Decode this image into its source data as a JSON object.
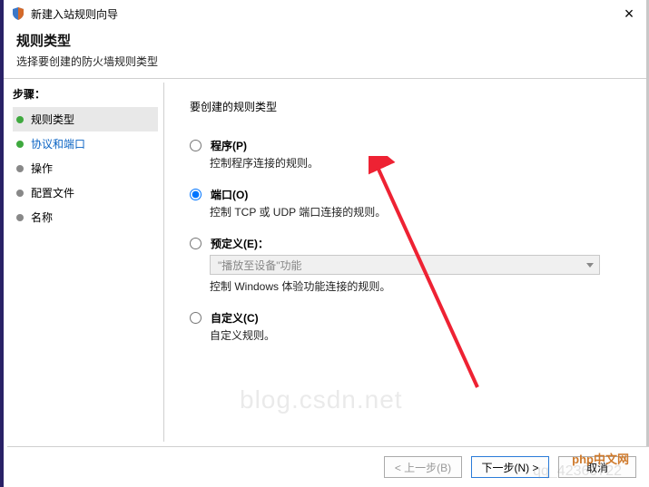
{
  "window": {
    "title": "新建入站规则向导",
    "close_label": "×"
  },
  "header": {
    "title": "规则类型",
    "subtitle": "选择要创建的防火墙规则类型"
  },
  "sidebar": {
    "title": "步骤：",
    "steps": [
      {
        "label": "规则类型",
        "current": true,
        "color": "green",
        "link": false
      },
      {
        "label": "协议和端口",
        "current": false,
        "color": "green",
        "link": true
      },
      {
        "label": "操作",
        "current": false,
        "color": "gray",
        "link": false
      },
      {
        "label": "配置文件",
        "current": false,
        "color": "gray",
        "link": false
      },
      {
        "label": "名称",
        "current": false,
        "color": "gray",
        "link": false
      }
    ]
  },
  "main": {
    "prompt": "要创建的规则类型",
    "options": [
      {
        "id": "program",
        "label": "程序(P)",
        "desc": "控制程序连接的规则。",
        "checked": false
      },
      {
        "id": "port",
        "label": "端口(O)",
        "desc": "控制 TCP 或 UDP 端口连接的规则。",
        "checked": true
      },
      {
        "id": "predefined",
        "label": "预定义(E)：",
        "desc": "控制 Windows 体验功能连接的规则。",
        "checked": false,
        "dropdown": "\"播放至设备\"功能"
      },
      {
        "id": "custom",
        "label": "自定义(C)",
        "desc": "自定义规则。",
        "checked": false
      }
    ]
  },
  "footer": {
    "back": "< 上一步(B)",
    "next": "下一步(N) >",
    "cancel": "取消"
  },
  "watermark": {
    "wm1": "blog.csdn.net",
    "wm2": "qq_42360722",
    "badge": "php中文网"
  }
}
